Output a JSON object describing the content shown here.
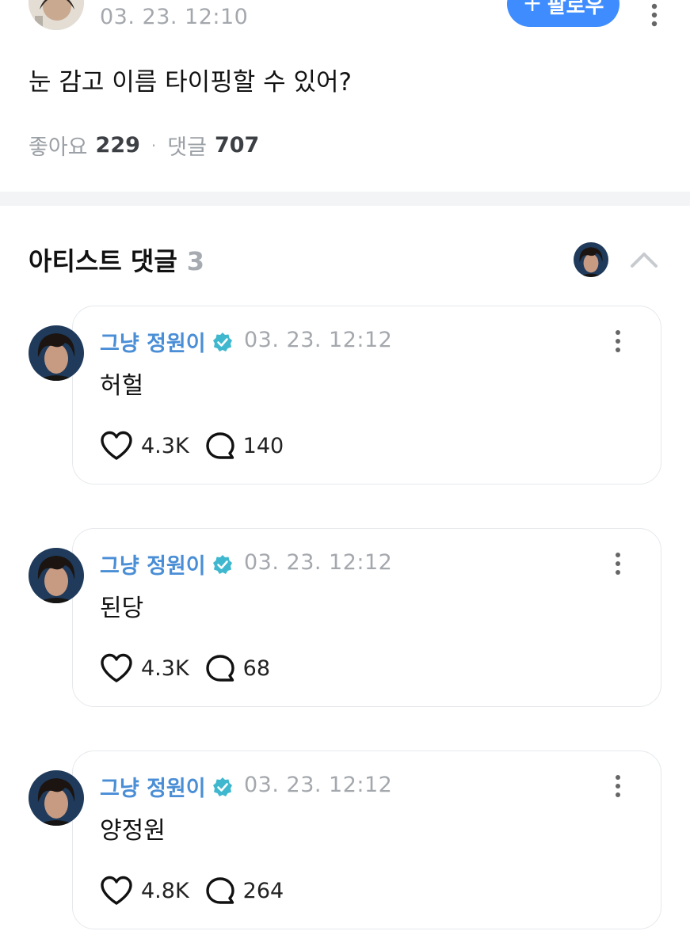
{
  "post": {
    "time": "03. 23. 12:10",
    "follow_label": "팔로우",
    "follow_icon": "+",
    "text": "눈 감고 이름 타이핑할 수 있어?",
    "likes_label": "좋아요",
    "likes_count": "229",
    "stats_separator": "·",
    "comments_label": "댓글",
    "comments_count": "707"
  },
  "artist_section": {
    "title": "아티스트 댓글",
    "count": "3",
    "collapse_icon": "chevron-up-icon"
  },
  "comments": [
    {
      "author": "그냥 정원이",
      "time": "03. 23. 12:12",
      "text": "허헐",
      "likes": "4.3K",
      "replies": "140"
    },
    {
      "author": "그냥 정원이",
      "time": "03. 23. 12:12",
      "text": "된당",
      "likes": "4.3K",
      "replies": "68"
    },
    {
      "author": "그냥 정원이",
      "time": "03. 23. 12:12",
      "text": "양정원",
      "likes": "4.8K",
      "replies": "264"
    }
  ],
  "colors": {
    "accent": "#3f8cff",
    "author": "#4a8ed6",
    "verified": "#3fb8cf",
    "muted": "#a4a8ad"
  }
}
